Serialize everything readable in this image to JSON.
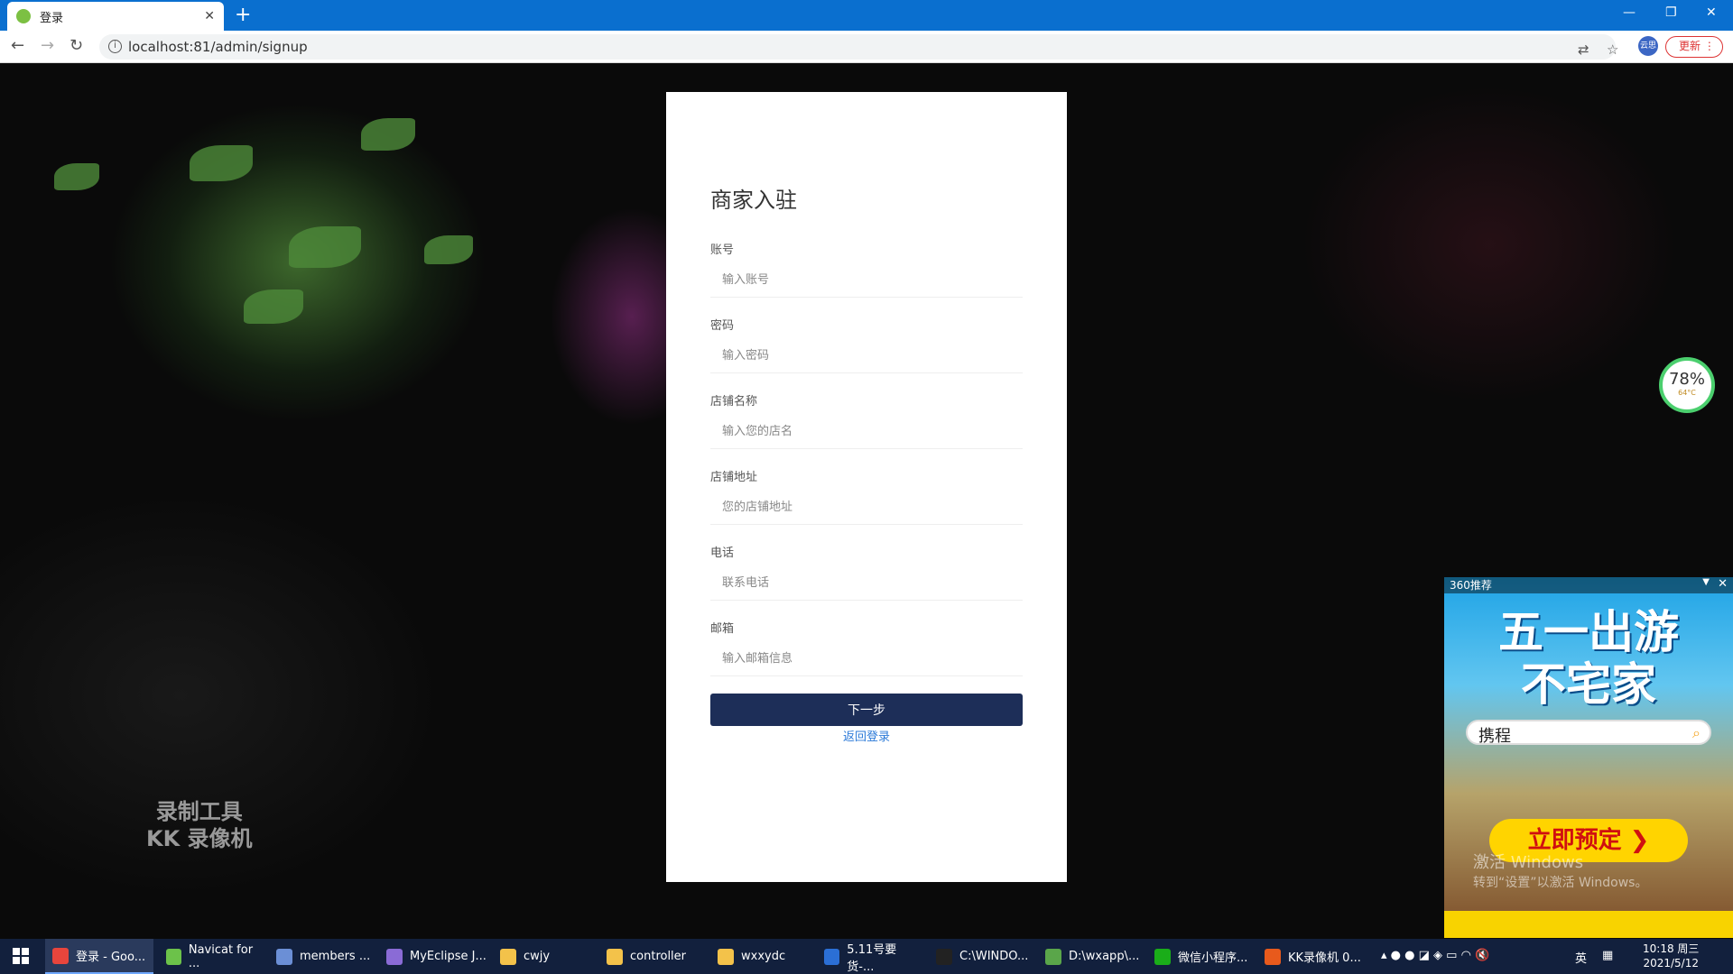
{
  "browser": {
    "tab_title": "登录",
    "new_tab": "+",
    "url": "localhost:81/admin/signup",
    "profile_label": "云思",
    "update_label": "更新"
  },
  "form": {
    "title": "商家入驻",
    "fields": [
      {
        "label": "账号",
        "placeholder": "输入账号"
      },
      {
        "label": "密码",
        "placeholder": "输入密码"
      },
      {
        "label": "店铺名称",
        "placeholder": "输入您的店名"
      },
      {
        "label": "店铺地址",
        "placeholder": "您的店铺地址"
      },
      {
        "label": "电话",
        "placeholder": "联系电话"
      },
      {
        "label": "邮箱",
        "placeholder": "输入邮箱信息"
      }
    ],
    "submit_label": "下一步",
    "back_link": "返回登录"
  },
  "watermark": {
    "line1": "录制工具",
    "line2": "KK 录像机"
  },
  "gauge": {
    "percent": "78%",
    "temp": "64°C"
  },
  "ad": {
    "header": "360推荐",
    "headline_line1": "五一出游",
    "headline_line2": "不宅家",
    "search_text": "携程",
    "cta": "立即预定 ❯",
    "activate_line1": "激活 Windows",
    "activate_line2": "转到“设置”以激活 Windows。"
  },
  "taskbar": {
    "items": [
      {
        "label": "登录 - Goo...",
        "color": "#e8453c"
      },
      {
        "label": "Navicat for ...",
        "color": "#6cc24a"
      },
      {
        "label": "members ...",
        "color": "#6b8fd6"
      },
      {
        "label": "MyEclipse J...",
        "color": "#8a6bd6"
      },
      {
        "label": "cwjy",
        "color": "#f3c24a"
      },
      {
        "label": "controller",
        "color": "#f3c24a"
      },
      {
        "label": "wxxydc",
        "color": "#f3c24a"
      },
      {
        "label": "5.11号要货-...",
        "color": "#2b6fd6"
      },
      {
        "label": "C:\\WINDO...",
        "color": "#222222"
      },
      {
        "label": "D:\\wxapp\\...",
        "color": "#5aa64a"
      },
      {
        "label": "微信小程序...",
        "color": "#1aad19"
      },
      {
        "label": "KK录像机 0...",
        "color": "#e85a1c"
      }
    ],
    "ime": "英",
    "time": "10:18 周三",
    "date": "2021/5/12"
  }
}
